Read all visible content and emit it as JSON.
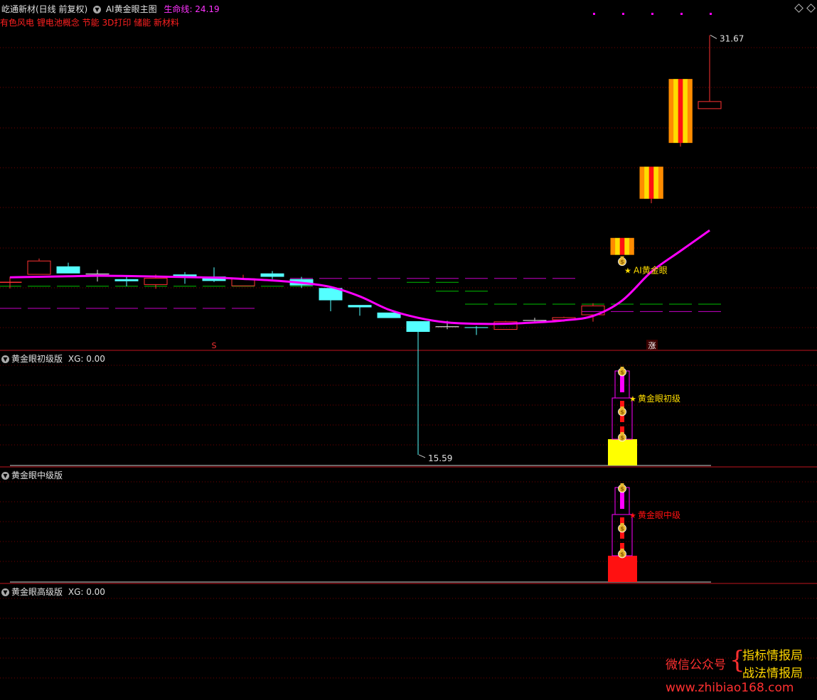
{
  "colors": {
    "background": "#000000",
    "up": "#ff3232",
    "down": "#54ffff",
    "ma_line": "#ff00ff",
    "panel_divider": "#c0141e",
    "grid": "#780000",
    "gold_yellow": "#ffdd00",
    "gold_orange": "#ff8c00",
    "gold_red": "#ff1111",
    "flat_white": "#e0e0e0",
    "green_dash": "#00c000",
    "magenta_dash": "#c800c8",
    "concept_text": "#ff2020",
    "header_text": "#e0e0e0",
    "lifeline_label": "#ff33ff",
    "dollar_bag": "#e8b830",
    "primary_bar": "#ffff00",
    "mid_bar": "#ff1111",
    "watermark_red": "#ff3030",
    "watermark_gold": "#ffd700"
  },
  "header": {
    "stock_title": "屹通新材(日线 前复权)",
    "indicator_name": "AI黄金眼主图",
    "lifeline_label": "生命线",
    "lifeline_value": "24.19",
    "concepts": "有色风电 锂电池概念 节能 3D打印 储能 新材料"
  },
  "panels": {
    "primary": {
      "title": "黄金眼初级版",
      "xg": "XG: 0.00",
      "signal_label": "黄金眼初级"
    },
    "mid": {
      "title": "黄金眼中级版",
      "signal_label": "黄金眼中级"
    },
    "advanced": {
      "title": "黄金眼高级版",
      "xg": "XG: 0.00"
    }
  },
  "icons": {
    "dropdown": "chevron-down-circle-icon",
    "money_bag": "money-bag-icon",
    "star": "star-icon",
    "diamond": "diamond-icon",
    "brace": "curly-brace-icon"
  },
  "watermark": {
    "wechat_label": "微信公众号",
    "line1": "指标情报局",
    "line2": "战法情报局",
    "url": "www.zhibiao168.com"
  },
  "chart_data": {
    "type": "candlestick",
    "candles": [
      {
        "o": 22.18,
        "h": 22.41,
        "l": 21.96,
        "c": 22.22
      },
      {
        "o": 22.49,
        "h": 23.11,
        "l": 22.49,
        "c": 23.03
      },
      {
        "o": 22.81,
        "h": 22.95,
        "l": 22.54,
        "c": 22.54
      },
      {
        "o": 22.52,
        "h": 22.68,
        "l": 22.23,
        "c": 22.52
      },
      {
        "o": 22.32,
        "h": 22.47,
        "l": 22.05,
        "c": 22.24
      },
      {
        "o": 22.1,
        "h": 22.5,
        "l": 21.95,
        "c": 22.37
      },
      {
        "o": 22.5,
        "h": 22.59,
        "l": 22.14,
        "c": 22.39
      },
      {
        "o": 22.42,
        "h": 22.77,
        "l": 22.21,
        "c": 22.25
      },
      {
        "o": 22.05,
        "h": 22.49,
        "l": 22.05,
        "c": 22.35
      },
      {
        "o": 22.54,
        "h": 22.63,
        "l": 22.32,
        "c": 22.41
      },
      {
        "o": 22.32,
        "h": 22.41,
        "l": 21.98,
        "c": 22.08
      },
      {
        "o": 21.98,
        "h": 21.98,
        "l": 21.09,
        "c": 21.51
      },
      {
        "o": 21.33,
        "h": 21.33,
        "l": 20.92,
        "c": 21.24
      },
      {
        "o": 21.04,
        "h": 21.04,
        "l": 20.83,
        "c": 20.83
      },
      {
        "o": 20.71,
        "h": 20.71,
        "l": 15.59,
        "c": 20.3
      },
      {
        "o": 20.5,
        "h": 20.72,
        "l": 20.4,
        "c": 20.5
      },
      {
        "o": 20.48,
        "h": 20.52,
        "l": 20.18,
        "c": 20.45
      },
      {
        "o": 20.38,
        "h": 20.72,
        "l": 20.38,
        "c": 20.7
      },
      {
        "o": 20.74,
        "h": 20.84,
        "l": 20.63,
        "c": 20.74
      },
      {
        "o": 20.75,
        "h": 20.88,
        "l": 20.69,
        "c": 20.86
      },
      {
        "o": 20.94,
        "h": 21.4,
        "l": 20.69,
        "c": 21.31
      },
      {
        "o": 23.25,
        "h": 23.9,
        "l": 23.25,
        "c": 23.9
      },
      {
        "o": 25.4,
        "h": 26.63,
        "l": 25.23,
        "c": 26.63
      },
      {
        "o": 27.54,
        "h": 29.99,
        "l": 27.4,
        "c": 29.99
      },
      {
        "o": 28.84,
        "h": 31.67,
        "l": 28.84,
        "c": 29.14
      }
    ],
    "limit_up_indices": [
      21,
      22,
      23
    ],
    "lifeline": [
      22.39,
      22.41,
      22.43,
      22.45,
      22.44,
      22.42,
      22.4,
      22.38,
      22.33,
      22.27,
      22.18,
      22.02,
      21.66,
      21.15,
      20.84,
      20.66,
      20.61,
      20.61,
      20.66,
      20.74,
      20.91,
      21.5,
      22.6,
      23.4,
      24.19
    ],
    "green_segments": [
      {
        "from": 0,
        "to": 10,
        "y": 22.05
      },
      {
        "from": 14,
        "to": 15,
        "y": 22.2
      },
      {
        "from": 15,
        "to": 16,
        "y": 21.86
      },
      {
        "from": 16,
        "to": 24,
        "y": 21.36
      }
    ],
    "magenta_segments": [
      {
        "from": 10,
        "to": 19,
        "y": 22.35
      },
      {
        "from": 0,
        "to": 8,
        "y": 21.2
      },
      {
        "from": 20,
        "to": 24,
        "y": 21.08
      }
    ],
    "annotations": {
      "high_label": "31.67",
      "low_label": "15.59",
      "signal_label": "AI黄金眼",
      "s_marker": "S",
      "zhang_marker": "涨"
    },
    "ylim": [
      20.0,
      32.2
    ]
  }
}
